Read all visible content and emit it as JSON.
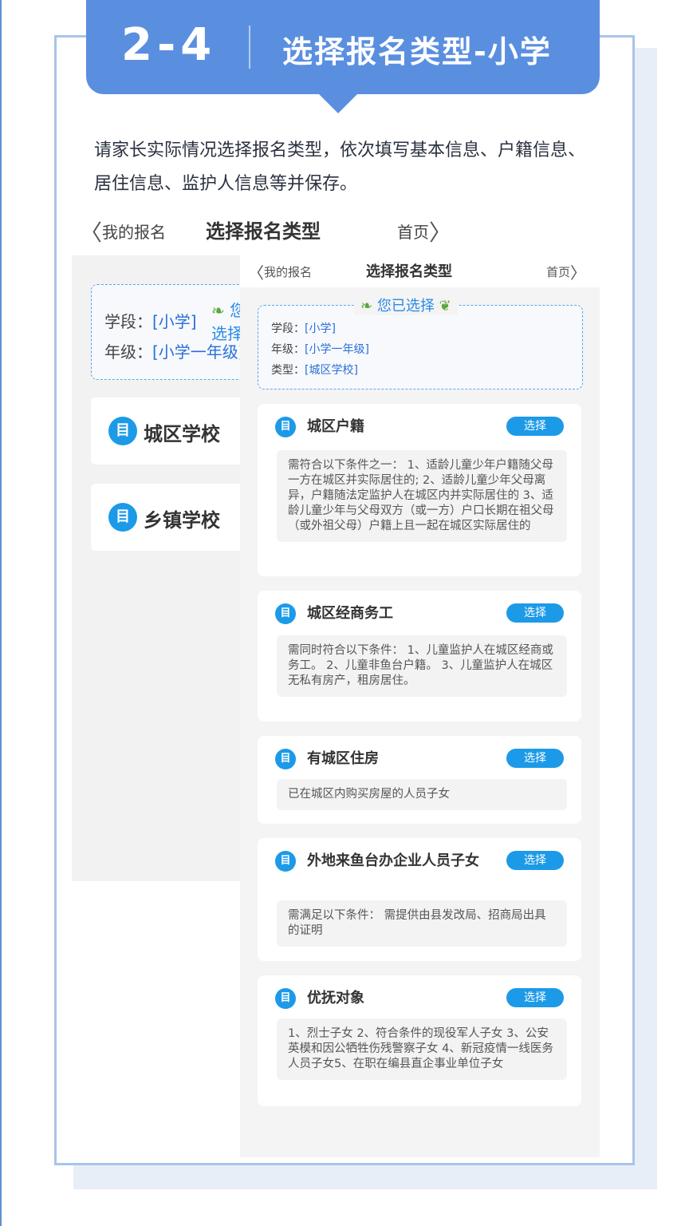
{
  "banner": {
    "number": "2-4",
    "title": "选择报名类型-小学"
  },
  "intro": "请家长实际情况选择报名类型，依次填写基本信息、户籍信息、居住信息、监护人信息等并保存。",
  "back_nav": {
    "back": "我的报名",
    "title": "选择报名类型",
    "home": "首页"
  },
  "back_screen": {
    "selected_header": "您已选择",
    "rows": [
      {
        "label": "学段：",
        "value": "[小学]"
      },
      {
        "label": "年级：",
        "value": "[小学一年级]"
      }
    ],
    "schools": [
      "城区学校",
      "乡镇学校"
    ]
  },
  "front_nav": {
    "back": "我的报名",
    "title": "选择报名类型",
    "home": "首页"
  },
  "front_screen": {
    "selected_header": "您已选择",
    "rows": [
      {
        "label": "学段：",
        "value": "[小学]"
      },
      {
        "label": "年级：",
        "value": "[小学一年级]"
      },
      {
        "label": "类型：",
        "value": "[城区学校]"
      }
    ],
    "select_label": "选择",
    "cards": [
      {
        "title": "城区户籍",
        "desc": "需符合以下条件之一： 1、适龄儿童少年户籍随父母一方在城区并实际居住的; 2、适龄儿童少年父母离异，户籍随法定监护人在城区内并实际居住的 3、适龄儿童少年与父母双方（或一方）户口长期在祖父母（或外祖父母）户籍上且一起在城区实际居住的"
      },
      {
        "title": "城区经商务工",
        "desc": "需同时符合以下条件： 1、儿童监护人在城区经商或务工。 2、儿童非鱼台户籍。 3、儿童监护人在城区无私有房产，租房居住。"
      },
      {
        "title": "有城区住房",
        "desc": "已在城区内购买房屋的人员子女"
      },
      {
        "title": "外地来鱼台办企业人员子女",
        "desc": "需满足以下条件： 需提供由县发改局、招商局出具的证明"
      },
      {
        "title": "优抚对象",
        "desc": "1、烈士子女 2、符合条件的现役军人子女 3、公安英模和因公牺牲伤残警察子女 4、新冠疫情一线医务人员子女5、在职在编县直企事业单位子女"
      }
    ]
  }
}
